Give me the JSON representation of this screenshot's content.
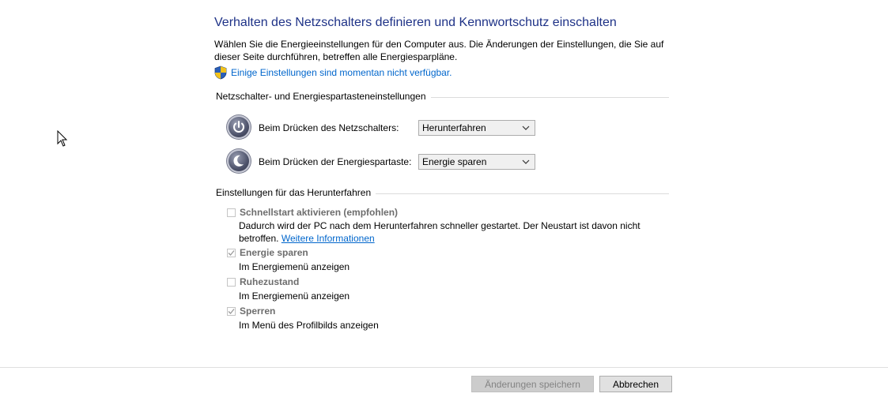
{
  "header": {
    "title": "Verhalten des Netzschalters definieren und Kennwortschutz einschalten",
    "intro": "Wählen Sie die Energieeinstellungen für den Computer aus. Die Änderungen der Einstellungen, die Sie auf dieser Seite durchführen, betreffen alle Energiesparpläne.",
    "shield_link": "Einige Einstellungen sind momentan nicht verfügbar."
  },
  "button_settings": {
    "section_label": "Netzschalter- und Energiespartasteneinstellungen",
    "rows": [
      {
        "label": "Beim Drücken des Netzschalters:",
        "value": "Herunterfahren",
        "icon": "power-button-icon"
      },
      {
        "label": "Beim Drücken der Energiespartaste:",
        "value": "Energie sparen",
        "icon": "sleep-button-icon"
      }
    ]
  },
  "shutdown_settings": {
    "section_label": "Einstellungen für das Herunterfahren",
    "options": [
      {
        "title": "Schnellstart aktivieren (empfohlen)",
        "desc": "Dadurch wird der PC nach dem Herunterfahren schneller gestartet. Der Neustart ist davon nicht betroffen.",
        "link": "Weitere Informationen",
        "checked": false
      },
      {
        "title": "Energie sparen",
        "desc": "Im Energiemenü anzeigen",
        "checked": true
      },
      {
        "title": "Ruhezustand",
        "desc": "Im Energiemenü anzeigen",
        "checked": false
      },
      {
        "title": "Sperren",
        "desc": "Im Menü des Profilbilds anzeigen",
        "checked": true
      }
    ]
  },
  "footer": {
    "save_label": "Änderungen speichern",
    "cancel_label": "Abbrechen"
  }
}
